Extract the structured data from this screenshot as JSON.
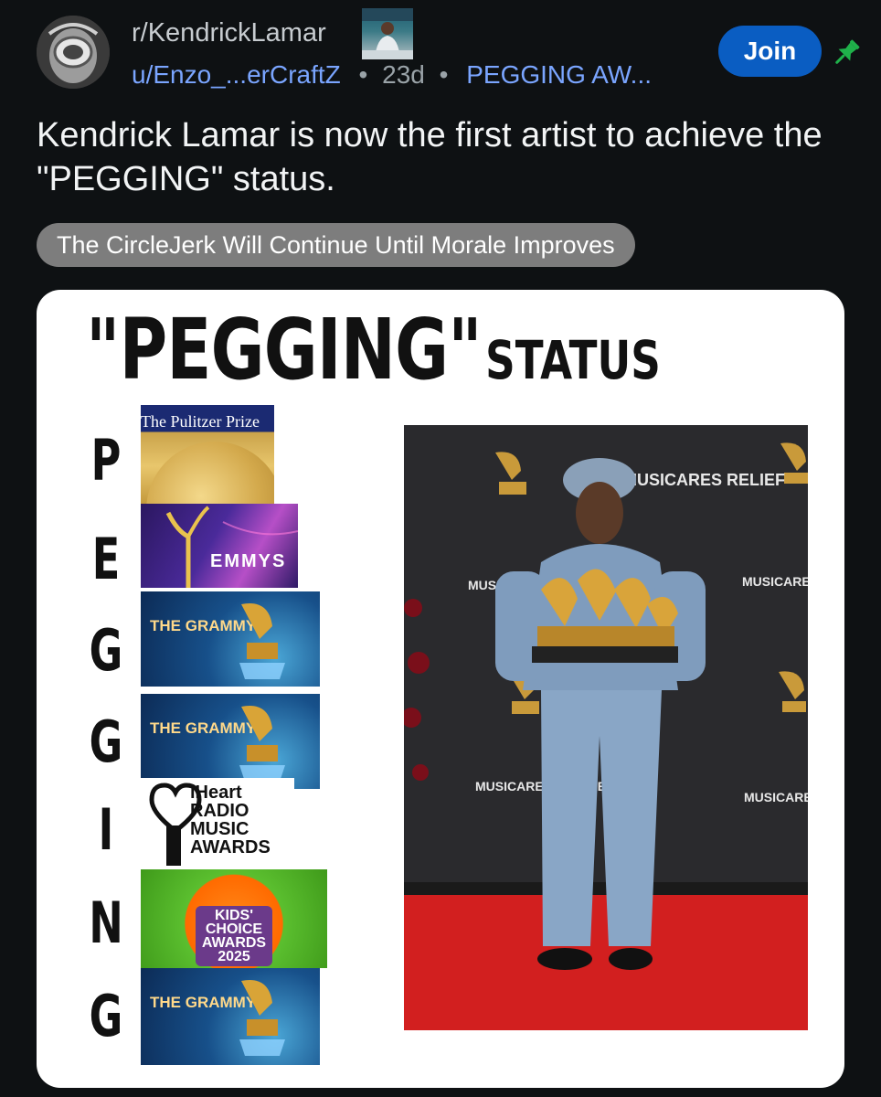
{
  "header": {
    "subreddit": "r/KendrickLamar",
    "author": "u/Enzo_...erCraftZ",
    "separator": "•",
    "age": "23d",
    "user_flair": "PEGGING AW...",
    "join_label": "Join",
    "icons": [
      "subreddit-avatar",
      "flair-image",
      "pin-icon"
    ]
  },
  "post": {
    "title": "Kendrick Lamar is now the first artist to achieve the \"PEGGING\" status.",
    "flair": "The CircleJerk Will Continue Until Morale Improves"
  },
  "image": {
    "title_big": "\"PEGGING\"",
    "title_small": "STATUS",
    "letters": [
      "P",
      "E",
      "G",
      "G",
      "I",
      "N",
      "G"
    ],
    "logos": {
      "pulitzer": "The Pulitzer Prize",
      "emmys": "EMMYS",
      "grammys_1": "THE GRAMMYS",
      "grammys_2": "THE GRAMMYS",
      "iheart": "iHeart RADIO MUSIC AWARDS",
      "kca": "KIDS' CHOICE AWARDS 2025",
      "grammys_3": "THE GRAMMYS"
    },
    "backdrop_text": [
      "MUSICARES RELIEF",
      "MUSICARES FIRE RELIEF"
    ]
  },
  "colors": {
    "background": "#0e1113",
    "join_button": "#0a5dc2",
    "link_blue": "#7aa5ff",
    "flair_bg": "#7d7d7d",
    "pin": "#1fb14a",
    "carpet": "#d21f1f"
  }
}
